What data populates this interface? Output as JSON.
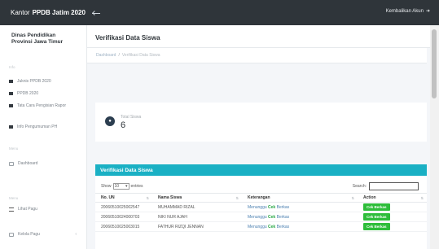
{
  "app": {
    "brand_prefix": "Kantor",
    "brand_name": "PPDB Jatim 2020",
    "back_label": "Kembalikan Akun",
    "back_icon": "sign-out-icon"
  },
  "sidebar": {
    "org_line1": "Dinas Pendidikan",
    "org_line2": "Provinsi Jawa Timur",
    "heading_1": "Info",
    "items_1": [
      {
        "label": "Juknis PPDB 2020"
      },
      {
        "label": "PPDB 2020"
      },
      {
        "label": "Tata Cara Pengisian Rapor"
      },
      {
        "label": "Info Pengumuman PH"
      }
    ],
    "heading_2": "Menu",
    "dashboard_label": "Dashboard",
    "heading_3": "Menu",
    "menu_items": [
      {
        "label": "Lihat Pagu"
      },
      {
        "label": "Kelola Pagu"
      }
    ]
  },
  "page": {
    "title": "Verifikasi Data Siswa",
    "breadcrumb_home": "Dashboard",
    "breadcrumb_current": "Verifikasi Data Siswa"
  },
  "stat": {
    "label": "Total Siswa",
    "value": "6"
  },
  "panel": {
    "title": "Verifikasi Data Siswa",
    "show_label": "Show",
    "show_value": "10",
    "entries_label": "entries",
    "search_label": "Search:"
  },
  "table": {
    "columns": [
      "No. UN",
      "Nama Siswa",
      "Keterangan",
      "Action"
    ],
    "rows": [
      {
        "no_un": "20060510025002547",
        "nama": "MUHAMMAD RIZAL",
        "ket_prefix": "Menunggu",
        "ket_bold": "Cek",
        "ket_suffix": "Berkas",
        "action": "Cek Berkas"
      },
      {
        "no_un": "20060510024000703",
        "nama": "NIKI NUR AJAH",
        "ket_prefix": "Menunggu",
        "ket_bold": "Cek",
        "ket_suffix": "Berkas",
        "action": "Cek Berkas"
      },
      {
        "no_un": "20060510025003015",
        "nama": "FATHUR RIZQI JENNAN",
        "ket_prefix": "Menunggu",
        "ket_bold": "Cek",
        "ket_suffix": "Berkas",
        "action": "Cek Berkas"
      }
    ]
  },
  "colors": {
    "topbar": "#2f353a",
    "panel_header": "#1ab0c4",
    "action_button": "#2ebd3a"
  }
}
